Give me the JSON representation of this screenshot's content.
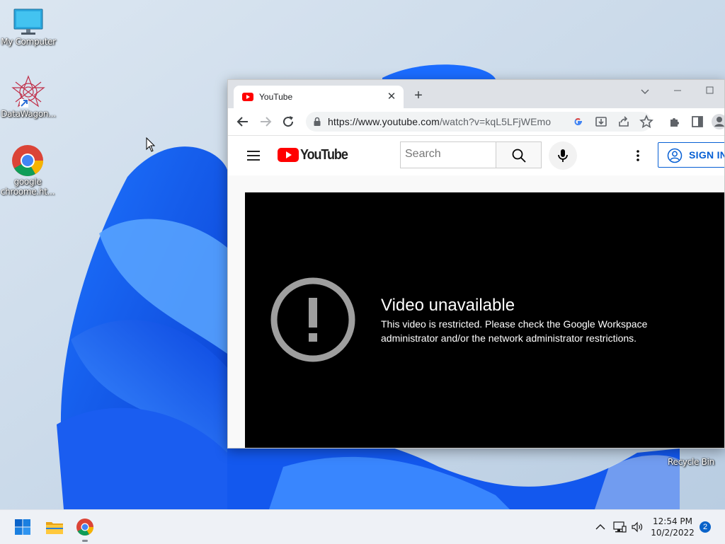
{
  "desktop": {
    "icons": [
      {
        "label": "My Computer"
      },
      {
        "label": "DataWagon..."
      },
      {
        "label": "google chroome.ht..."
      }
    ],
    "recycle_bin_label": "Recycle Bin"
  },
  "browser": {
    "tab_title": "YouTube",
    "url_host": "https://www.youtube.com",
    "url_path": "/watch?v=kqL5LFjWEmo"
  },
  "youtube": {
    "logo_text": "YouTube",
    "search_placeholder": "Search",
    "sign_in_label": "SIGN IN",
    "error_title": "Video unavailable",
    "error_message": "This video is restricted. Please check the Google Workspace administrator and/or the network administrator restrictions."
  },
  "taskbar": {
    "time": "12:54 PM",
    "date": "10/2/2022",
    "notification_count": "2"
  },
  "colors": {
    "youtube_red": "#ff0000",
    "sign_in_blue": "#065fd4",
    "windows_blue": "#0a63c9"
  }
}
